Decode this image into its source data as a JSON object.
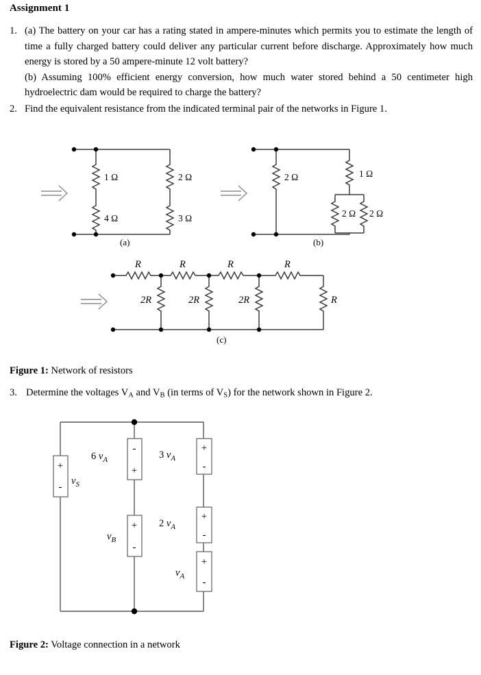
{
  "document": {
    "title": "Assignment 1"
  },
  "questions": [
    {
      "number": "1.",
      "parts": [
        "(a) The battery on your car has a rating stated in ampere-minutes which permits you to estimate the length of time a fully charged battery could deliver any particular current before discharge. Approximately how much energy is stored by a 50 ampere-minute 12 volt battery?",
        "(b) Assuming 100% efficient energy conversion, how much water stored behind a 50 centimeter high hydroelectric dam would be required to charge the battery?"
      ]
    },
    {
      "number": "2.",
      "text": "Find the equivalent resistance from the indicated terminal pair of the networks in Figure 1."
    }
  ],
  "question3": {
    "number": "3.",
    "text_before": "Determine the voltages V",
    "sub_a": "A",
    "text_mid1": " and V",
    "sub_b": "B",
    "text_mid2": " (in terms of V",
    "sub_s": "S",
    "text_after": ") for the network shown in Figure 2."
  },
  "figure1": {
    "caption_label": "Figure 1:",
    "caption_text": " Network of resistors",
    "subfigures": [
      {
        "id": "a",
        "label": "(a)",
        "resistors": [
          "1 Ω",
          "4 Ω",
          "2 Ω",
          "3 Ω"
        ]
      },
      {
        "id": "b",
        "label": "(b)",
        "resistors": [
          "2 Ω",
          "1 Ω",
          "2 Ω",
          "2 Ω"
        ]
      },
      {
        "id": "c",
        "label": "(c)",
        "series_labels": [
          "R",
          "R",
          "R",
          "R"
        ],
        "shunt_labels": [
          "2R",
          "2R",
          "2R"
        ],
        "terminator_label": "R"
      }
    ],
    "circuit_a": {
      "r_top_left": "1 Ω",
      "r_bottom_left": "4 Ω",
      "r_top_right": "2 Ω",
      "r_bottom_right": "3 Ω"
    },
    "circuit_b": {
      "r_shunt": "2 Ω",
      "r_series": "1 Ω",
      "r_par_left": "2 Ω",
      "r_par_right": "2 Ω"
    }
  },
  "figure2": {
    "caption_label": "Figure 2:",
    "caption_text": " Voltage connection in a network",
    "sources": [
      {
        "name": "source-vs",
        "label_main": "v",
        "label_sub": "S",
        "coefficient": "",
        "polarity_top": "+",
        "polarity_bottom": "-"
      },
      {
        "name": "source-6va",
        "label_main": "v",
        "label_sub": "A",
        "coefficient": "6",
        "polarity_top": "-",
        "polarity_bottom": "+"
      },
      {
        "name": "source-vb",
        "label_main": "v",
        "label_sub": "B",
        "coefficient": "",
        "polarity_top": "+",
        "polarity_bottom": "-"
      },
      {
        "name": "source-3va",
        "label_main": "v",
        "label_sub": "A",
        "coefficient": "3",
        "polarity_top": "+",
        "polarity_bottom": "-"
      },
      {
        "name": "source-2va",
        "label_main": "v",
        "label_sub": "A",
        "coefficient": "2",
        "polarity_top": "+",
        "polarity_bottom": "-"
      },
      {
        "name": "source-va",
        "label_main": "v",
        "label_sub": "A",
        "coefficient": "",
        "polarity_top": "+",
        "polarity_bottom": "-"
      }
    ]
  }
}
